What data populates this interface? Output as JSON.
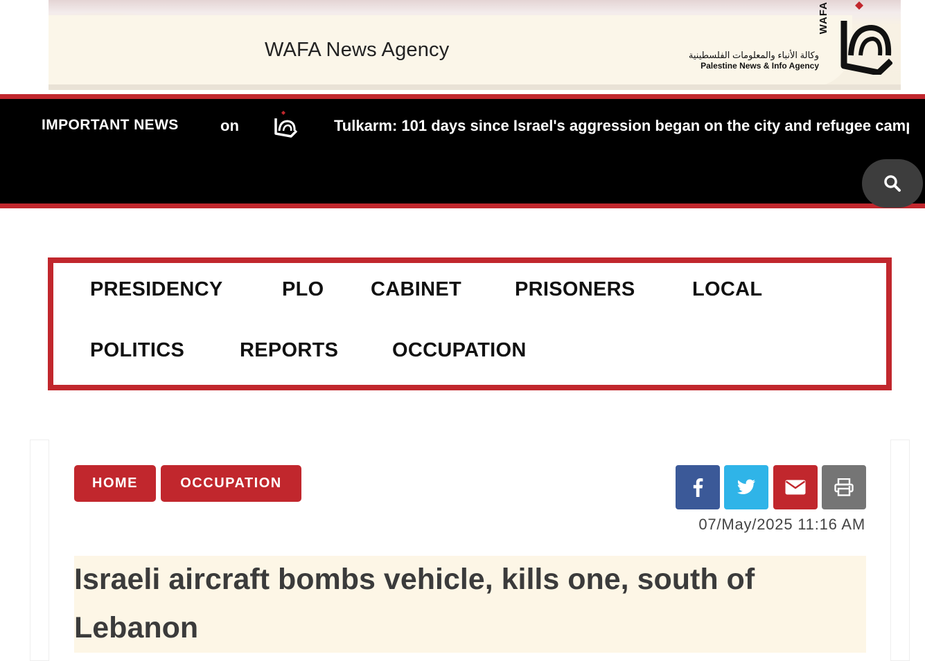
{
  "header": {
    "banner_title": "WAFA News Agency",
    "brand_arabic": "وكالة الأنباء والمعلومات الفلسطينية",
    "brand_english": "Palestine News & Info Agency",
    "brand_vertical": "WAFA",
    "brand_color": "#c1272d"
  },
  "ticker": {
    "label": "IMPORTANT NEWS",
    "previous_fragment": "on",
    "headline": "Tulkarm: 101 days since Israel's aggression began on the city and refugee camp",
    "search_icon": "search-icon"
  },
  "nav": {
    "items": [
      {
        "label": "PRESIDENCY"
      },
      {
        "label": "PLO"
      },
      {
        "label": "CABINET"
      },
      {
        "label": "PRISONERS"
      },
      {
        "label": "LOCAL"
      },
      {
        "label": "POLITICS"
      },
      {
        "label": "REPORTS"
      },
      {
        "label": "OCCUPATION"
      }
    ]
  },
  "article": {
    "breadcrumb": [
      {
        "label": "HOME"
      },
      {
        "label": "OCCUPATION"
      }
    ],
    "share_icons": [
      "facebook-icon",
      "twitter-icon",
      "envelope-icon",
      "printer-icon"
    ],
    "date": "07/May/2025 11:16 AM",
    "title": "Israeli aircraft bombs vehicle, kills one, south of Lebanon"
  },
  "colors": {
    "accent_red": "#c1272d",
    "ticker_bg": "#000000",
    "facebook": "#3b5998",
    "twitter": "#2fb4e8",
    "print": "#757575",
    "headline_highlight": "#fdf6e6"
  }
}
